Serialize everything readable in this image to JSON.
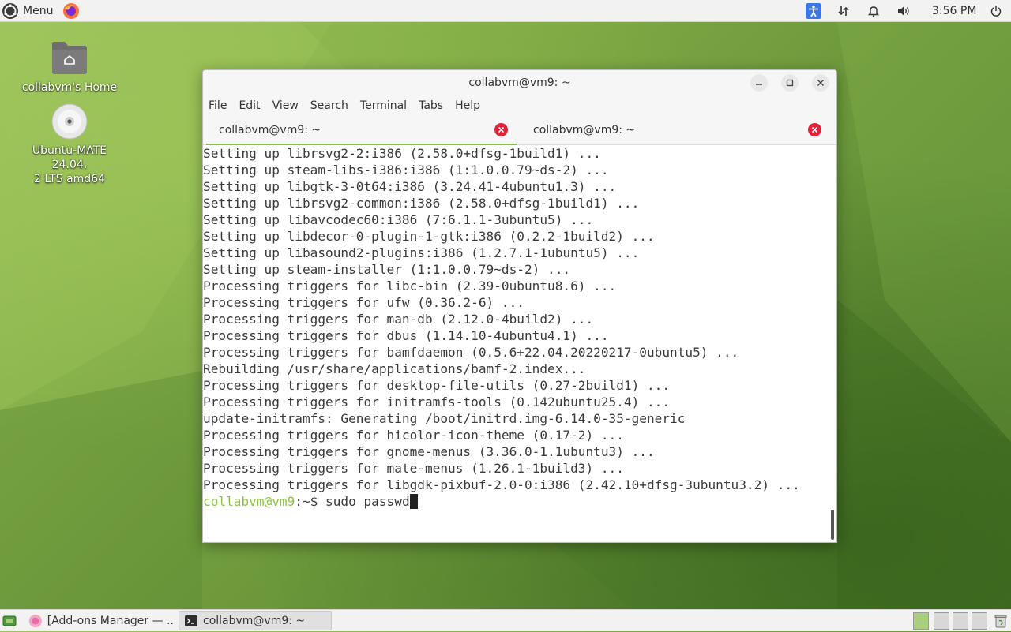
{
  "top_panel": {
    "menu_label": "Menu",
    "clock": "3:56 PM",
    "tray_icons": [
      "accessibility-icon",
      "network-icon",
      "notification-icon",
      "volume-icon",
      "power-icon"
    ]
  },
  "desktop": {
    "icons": [
      {
        "name": "home-folder",
        "label": "collabvm's Home"
      },
      {
        "name": "dvd-drive",
        "label_line1": "Ubuntu-MATE 24.04.",
        "label_line2": "2 LTS amd64"
      }
    ]
  },
  "terminal": {
    "title": "collabvm@vm9: ~",
    "menu": [
      "File",
      "Edit",
      "View",
      "Search",
      "Terminal",
      "Tabs",
      "Help"
    ],
    "tabs": [
      {
        "label": "collabvm@vm9: ~",
        "active": true
      },
      {
        "label": "collabvm@vm9: ~",
        "active": false
      }
    ],
    "output_lines": [
      "Setting up librsvg2-2:i386 (2.58.0+dfsg-1build1) ...",
      "Setting up steam-libs-i386:i386 (1:1.0.0.79~ds-2) ...",
      "Setting up libgtk-3-0t64:i386 (3.24.41-4ubuntu1.3) ...",
      "Setting up librsvg2-common:i386 (2.58.0+dfsg-1build1) ...",
      "Setting up libavcodec60:i386 (7:6.1.1-3ubuntu5) ...",
      "Setting up libdecor-0-plugin-1-gtk:i386 (0.2.2-1build2) ...",
      "Setting up libasound2-plugins:i386 (1.2.7.1-1ubuntu5) ...",
      "Setting up steam-installer (1:1.0.0.79~ds-2) ...",
      "Processing triggers for libc-bin (2.39-0ubuntu8.6) ...",
      "Processing triggers for ufw (0.36.2-6) ...",
      "Processing triggers for man-db (2.12.0-4build2) ...",
      "Processing triggers for dbus (1.14.10-4ubuntu4.1) ...",
      "Processing triggers for bamfdaemon (0.5.6+22.04.20220217-0ubuntu5) ...",
      "Rebuilding /usr/share/applications/bamf-2.index...",
      "Processing triggers for desktop-file-utils (0.27-2build1) ...",
      "Processing triggers for initramfs-tools (0.142ubuntu25.4) ...",
      "update-initramfs: Generating /boot/initrd.img-6.14.0-35-generic",
      "Processing triggers for hicolor-icon-theme (0.17-2) ...",
      "Processing triggers for gnome-menus (3.36.0-1.1ubuntu3) ...",
      "Processing triggers for mate-menus (1.26.1-1build3) ...",
      "Processing triggers for libgdk-pixbuf-2.0-0:i386 (2.42.10+dfsg-3ubuntu3.2) ..."
    ],
    "prompt": {
      "user_host": "collabvm@vm9",
      "path": ":~$ ",
      "command": "sudo passwd"
    }
  },
  "taskbar": {
    "tasks": [
      {
        "label": "[Add-ons Manager — ...",
        "active": false
      },
      {
        "label": "collabvm@vm9: ~",
        "active": true
      }
    ]
  },
  "colors": {
    "prompt_user": "#8ac63d",
    "tab_active_underline": "#8bbd4a",
    "tab_close": "#e0243a",
    "desktop_green": "#7aa844"
  }
}
